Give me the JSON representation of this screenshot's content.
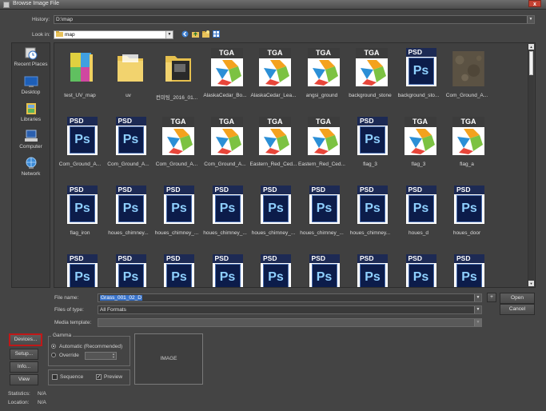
{
  "window": {
    "title": "Browse Image File",
    "close_label": "x"
  },
  "history": {
    "label": "History:",
    "value": "D:\\map"
  },
  "lookin": {
    "label": "Look in:",
    "value": "map"
  },
  "places": [
    {
      "label": "Recent Places",
      "icon": "recent-places-icon"
    },
    {
      "label": "Desktop",
      "icon": "desktop-icon"
    },
    {
      "label": "Libraries",
      "icon": "libraries-icon"
    },
    {
      "label": "Computer",
      "icon": "computer-icon"
    },
    {
      "label": "Network",
      "icon": "network-icon"
    }
  ],
  "files": [
    {
      "name": "test_UV_map",
      "type": "book"
    },
    {
      "name": "uv",
      "type": "folder"
    },
    {
      "name": "컨미팅_2016_01...",
      "type": "folder-dark"
    },
    {
      "name": "AlaskaCedar_Bo...",
      "type": "tga"
    },
    {
      "name": "AlaskaCedar_Lea...",
      "type": "tga"
    },
    {
      "name": "angsi_ground",
      "type": "tga"
    },
    {
      "name": "background_stone",
      "type": "tga"
    },
    {
      "name": "background_sto...",
      "type": "psd"
    },
    {
      "name": "Com_Ground_A...",
      "type": "image"
    },
    {
      "name": "Com_Ground_A...",
      "type": "psd"
    },
    {
      "name": "Com_Ground_A...",
      "type": "psd"
    },
    {
      "name": "Com_Ground_A...",
      "type": "tga"
    },
    {
      "name": "Com_Ground_A...",
      "type": "tga"
    },
    {
      "name": "Eastern_Red_Ced...",
      "type": "tga"
    },
    {
      "name": "Eastern_Red_Ced...",
      "type": "tga"
    },
    {
      "name": "flag_3",
      "type": "psd"
    },
    {
      "name": "flag_3",
      "type": "tga"
    },
    {
      "name": "flag_a",
      "type": "tga"
    },
    {
      "name": "flag_iron",
      "type": "psd"
    },
    {
      "name": "houes_chimney...",
      "type": "psd"
    },
    {
      "name": "houes_chimney_...",
      "type": "psd"
    },
    {
      "name": "houes_chimney_...",
      "type": "psd"
    },
    {
      "name": "houes_chimney_...",
      "type": "psd"
    },
    {
      "name": "houes_chimney_...",
      "type": "psd"
    },
    {
      "name": "houes_chimney...",
      "type": "psd"
    },
    {
      "name": "houes_d",
      "type": "psd"
    },
    {
      "name": "houes_door",
      "type": "psd"
    },
    {
      "name": "",
      "type": "psd"
    },
    {
      "name": "",
      "type": "psd"
    },
    {
      "name": "",
      "type": "psd"
    },
    {
      "name": "",
      "type": "psd"
    },
    {
      "name": "",
      "type": "psd"
    },
    {
      "name": "",
      "type": "psd"
    },
    {
      "name": "",
      "type": "psd"
    },
    {
      "name": "",
      "type": "psd"
    },
    {
      "name": "",
      "type": "psd"
    }
  ],
  "icon_labels": {
    "psd_badge": "PSD",
    "psd_mark": "Ps",
    "tga_badge": "TGA"
  },
  "filename": {
    "label": "File name:",
    "value": "Grass_001_02_D"
  },
  "filetype": {
    "label": "Files of type:",
    "value": "All Formats"
  },
  "template": {
    "label": "Media template:",
    "value": ""
  },
  "buttons": {
    "plus": "+",
    "open": "Open",
    "cancel": "Cancel",
    "devices": "Devices...",
    "setup": "Setup...",
    "info": "Info...",
    "view": "View"
  },
  "gamma": {
    "title": "Gamma",
    "automatic": "Automatic (Recommended)",
    "override": "Override"
  },
  "options": {
    "sequence": "Sequence",
    "preview": "Preview"
  },
  "preview_box": "IMAGE",
  "stats": {
    "statistics_label": "Statistics:",
    "statistics_value": "N/A",
    "location_label": "Location:",
    "location_value": "N/A"
  }
}
